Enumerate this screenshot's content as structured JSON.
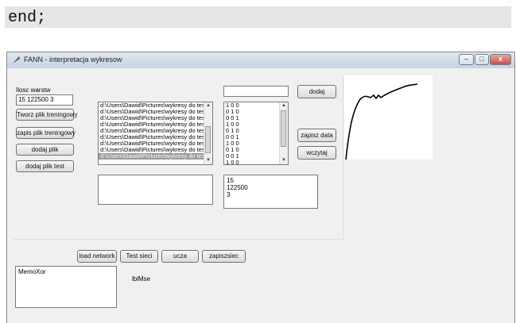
{
  "code_line": "end;",
  "window": {
    "title": "FANN - interpretacja wykresow",
    "buttons": [
      "–",
      "□",
      "x"
    ]
  },
  "form": {
    "layers_label": "Ilosc warstw",
    "layers_value": "15 122500 3",
    "create_training_label": "Tworz plik treningowy",
    "save_training_label": "zapis plik treningowy",
    "add_file_label": "dodaj plik",
    "add_test_file_label": "dodaj plik test",
    "top_input_value": "",
    "add_label": "dodaj",
    "save_data_label": "zapisz data",
    "load_label": "wczytaj",
    "files": [
      "d:\\Users\\Dawid\\Pictures\\wykresy do tes",
      "d:\\Users\\Dawid\\Pictures\\wykresy do tes",
      "d:\\Users\\Dawid\\Pictures\\wykresy do tes",
      "d:\\Users\\Dawid\\Pictures\\wykresy do tes",
      "d:\\Users\\Dawid\\Pictures\\wykresy do tes",
      "d:\\Users\\Dawid\\Pictures\\wykresy do tes",
      "d:\\Users\\Dawid\\Pictures\\wykresy do tes",
      "d:\\Users\\Dawid\\Pictures\\wykresy do tes",
      "d:\\Users\\Dawid\\Pictures\\wykresy do tes"
    ],
    "outputs": [
      "1 0 0",
      "0 1 0",
      "0 0 1",
      "1 0 0",
      "0 1 0",
      "0 0 1",
      "1 0 0",
      "0 1 0",
      "0 0 1",
      "1 0 0"
    ],
    "memo_left_lines": [],
    "memo_right_lines": [
      "15",
      "122500",
      "3"
    ]
  },
  "bottom": {
    "load_network_label": "load network",
    "test_label": "Test sieci",
    "train_label": "ucza",
    "save_net_label": "zapiszsiec",
    "memo_label": "MemoXor",
    "mse_label": "lblMse"
  }
}
